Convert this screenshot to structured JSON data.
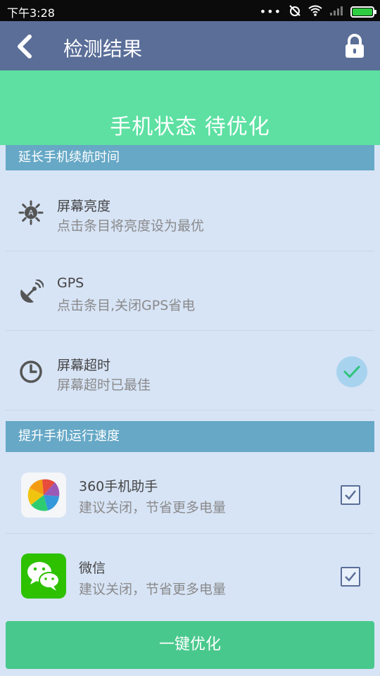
{
  "status_bar": {
    "time": "下午3:28",
    "icons": [
      "more-dots-icon",
      "alarm-off-icon",
      "wifi-icon",
      "signal-icon",
      "battery-icon"
    ]
  },
  "appbar": {
    "title": "检测结果",
    "back_icon": "back-chevron-icon",
    "lock_icon": "lock-icon"
  },
  "banner": {
    "status_text": "手机状态 待优化"
  },
  "sections": {
    "battery": {
      "header": "延长手机续航时间",
      "items": [
        {
          "title": "屏幕亮度",
          "subtitle": "点击条目将亮度设为最优",
          "icon": "brightness-icon"
        },
        {
          "title": "GPS",
          "subtitle": "点击条目,关闭GPS省电",
          "icon": "gps-satellite-icon"
        },
        {
          "title": "屏幕超时",
          "subtitle": "屏幕超时已最佳",
          "icon": "clock-icon",
          "status": "checked"
        }
      ]
    },
    "speed": {
      "header": "提升手机运行速度",
      "apps": [
        {
          "name": "360手机助手",
          "subtitle": "建议关闭，节省更多电量",
          "icon": "360-assistant-icon",
          "checked": true
        },
        {
          "name": "微信",
          "subtitle": "建议关闭，节省更多电量",
          "icon": "wechat-icon",
          "checked": true
        }
      ]
    }
  },
  "action": {
    "label": "一键优化"
  },
  "colors": {
    "appbar": "#5a6e98",
    "banner": "#5de0a2",
    "section_header": "#66a8c6",
    "background": "#d7e4f6",
    "button": "#48c88c",
    "check_circle": "#a8d3ee",
    "check_mark": "#2ec47a"
  }
}
